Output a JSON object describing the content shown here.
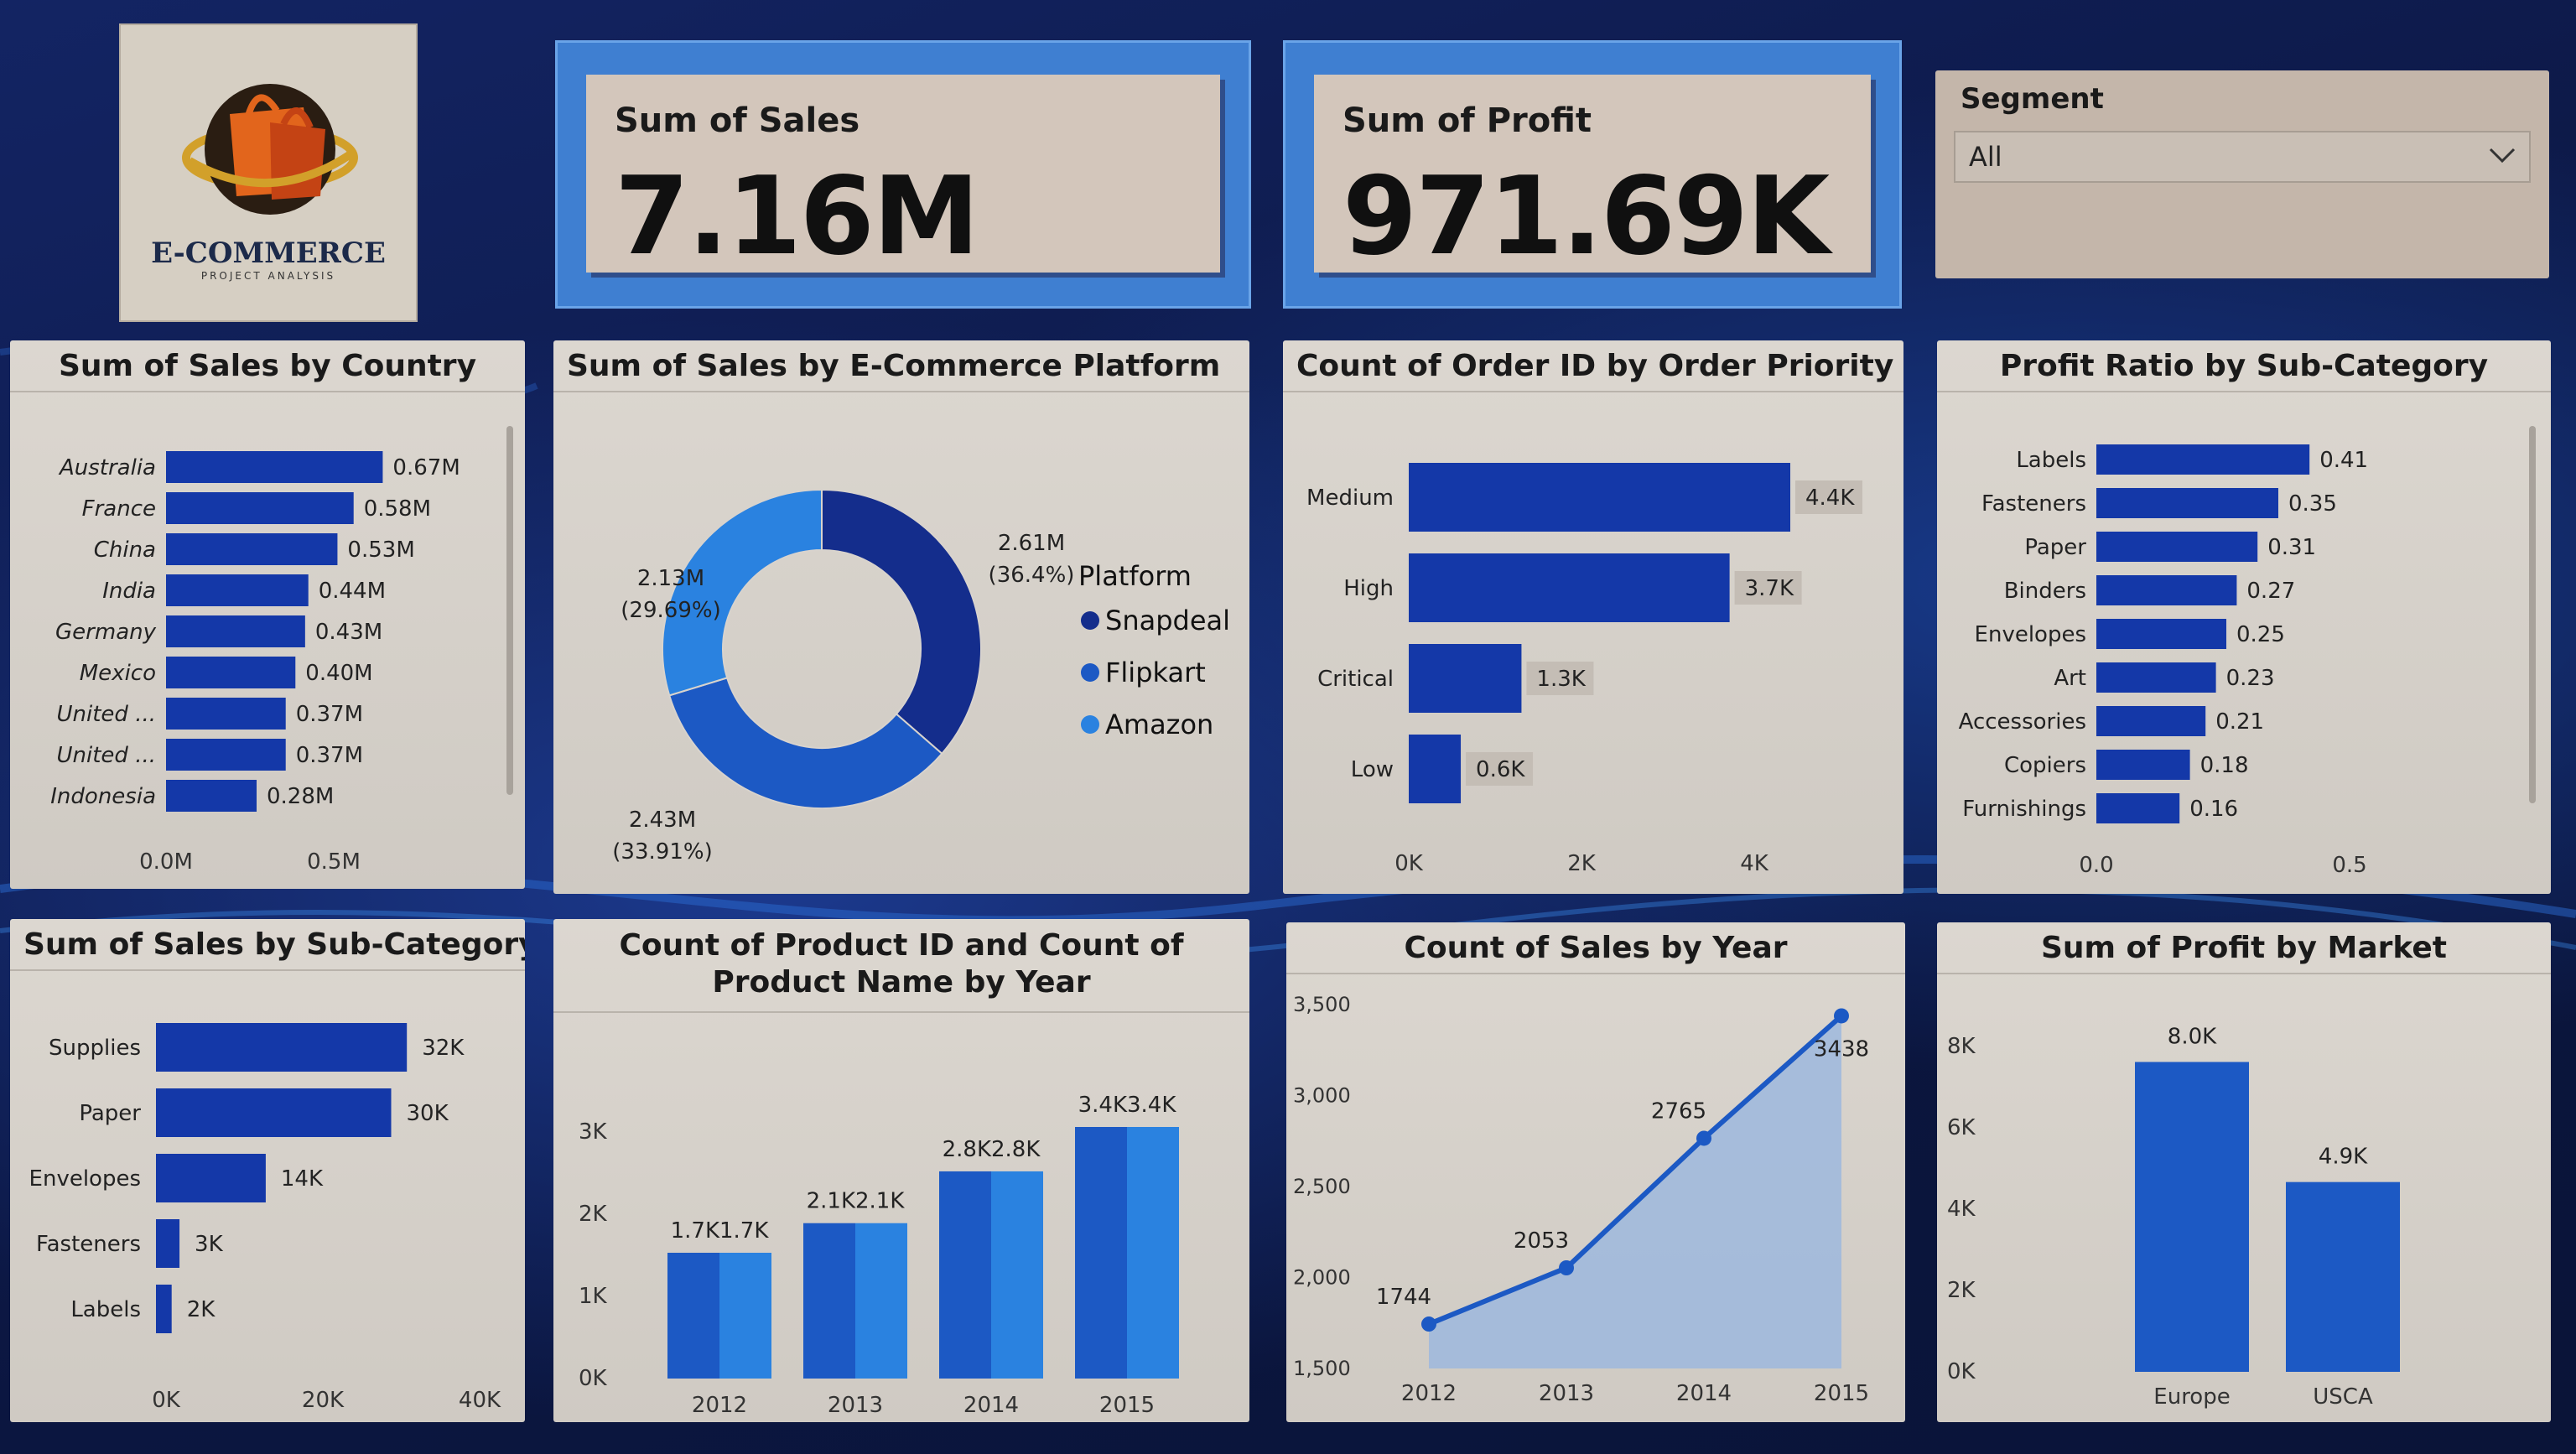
{
  "logo": {
    "name": "E-COMMERCE",
    "tagline": "PROJECT ANALYSIS"
  },
  "kpis": {
    "sales": {
      "label": "Sum of Sales",
      "value": "7.16M"
    },
    "profit": {
      "label": "Sum of Profit",
      "value": "971.69K"
    }
  },
  "segment": {
    "label": "Segment",
    "value": "All"
  },
  "colors": {
    "bar": "#1438a8",
    "bar_light": "#1f6fd6",
    "panel": "#d8d3cd",
    "accent": "#3f7fd1"
  },
  "chart_data": [
    {
      "id": "sales_by_country",
      "type": "bar",
      "orientation": "horizontal",
      "title": "Sum of Sales by Country",
      "categories": [
        "Australia",
        "France",
        "China",
        "India",
        "Germany",
        "Mexico",
        "United ...",
        "United ...",
        "Indonesia"
      ],
      "values": [
        0.67,
        0.58,
        0.53,
        0.44,
        0.43,
        0.4,
        0.37,
        0.37,
        0.28
      ],
      "labels": [
        "0.67M",
        "0.58M",
        "0.53M",
        "0.44M",
        "0.43M",
        "0.40M",
        "0.37M",
        "0.37M",
        "0.28M"
      ],
      "xlim": [
        0,
        0.7
      ],
      "xticks": [
        "0.0M",
        "0.5M"
      ]
    },
    {
      "id": "sales_by_platform",
      "type": "pie",
      "title": "Sum of Sales by E-Commerce Platform",
      "legend_title": "Platform",
      "slices": [
        {
          "name": "Snapdeal",
          "value": 2.61,
          "label": "2.61M",
          "pct": "(36.4%)",
          "color": "#142d8c"
        },
        {
          "name": "Flipkart",
          "value": 2.43,
          "label": "2.43M",
          "pct": "(33.91%)",
          "color": "#1c59c4"
        },
        {
          "name": "Amazon",
          "value": 2.13,
          "label": "2.13M",
          "pct": "(29.69%)",
          "color": "#2a82e0"
        }
      ]
    },
    {
      "id": "orders_by_priority",
      "type": "bar",
      "orientation": "horizontal",
      "title": "Count of Order ID by Order Priority",
      "categories": [
        "Medium",
        "High",
        "Critical",
        "Low"
      ],
      "values": [
        4.4,
        3.7,
        1.3,
        0.6
      ],
      "labels": [
        "4.4K",
        "3.7K",
        "1.3K",
        "0.6K"
      ],
      "xlim": [
        0,
        4.4
      ],
      "xticks": [
        "0K",
        "2K",
        "4K"
      ]
    },
    {
      "id": "profit_ratio_by_subcategory",
      "type": "bar",
      "orientation": "horizontal",
      "title": "Profit Ratio by Sub-Category",
      "categories": [
        "Labels",
        "Fasteners",
        "Paper",
        "Binders",
        "Envelopes",
        "Art",
        "Accessories",
        "Copiers",
        "Furnishings"
      ],
      "values": [
        0.41,
        0.35,
        0.31,
        0.27,
        0.25,
        0.23,
        0.21,
        0.18,
        0.16
      ],
      "labels": [
        "0.41",
        "0.35",
        "0.31",
        "0.27",
        "0.25",
        "0.23",
        "0.21",
        "0.18",
        "0.16"
      ],
      "xlim": [
        0,
        0.5
      ],
      "xticks": [
        "0.0",
        "0.5"
      ]
    },
    {
      "id": "sales_by_subcategory",
      "type": "bar",
      "orientation": "horizontal",
      "title": "Sum of Sales by Sub-Category",
      "categories": [
        "Supplies",
        "Paper",
        "Envelopes",
        "Fasteners",
        "Labels"
      ],
      "values": [
        32,
        30,
        14,
        3,
        2
      ],
      "labels": [
        "32K",
        "30K",
        "14K",
        "3K",
        "2K"
      ],
      "xlim": [
        0,
        40
      ],
      "xticks": [
        "0K",
        "20K",
        "40K"
      ]
    },
    {
      "id": "product_counts_by_year",
      "type": "bar",
      "title": "Count of Product ID and Count of Product Name by Year",
      "categories": [
        "2012",
        "2013",
        "2014",
        "2015"
      ],
      "series": [
        {
          "values": [
            1.7,
            2.1,
            2.8,
            3.4
          ],
          "labels": [
            "1.7K",
            "2.1K",
            "2.8K",
            "3.4K"
          ],
          "color": "#1c59c4"
        },
        {
          "values": [
            1.7,
            2.1,
            2.8,
            3.4
          ],
          "labels": [
            "1.7K",
            "2.1K",
            "2.8K",
            "3.4K"
          ],
          "color": "#2a82e0"
        }
      ],
      "ylim": [
        0,
        3.4
      ],
      "yticks": [
        "0K",
        "1K",
        "2K",
        "3K"
      ]
    },
    {
      "id": "sales_count_by_year",
      "type": "area",
      "title": "Count of Sales by Year",
      "x": [
        "2012",
        "2013",
        "2014",
        "2015"
      ],
      "values": [
        1744,
        2053,
        2765,
        3438
      ],
      "labels": [
        "1744",
        "2053",
        "2765",
        "3438"
      ],
      "ylim": [
        1500,
        3500
      ],
      "yticks": [
        "1,500",
        "2,000",
        "2,500",
        "3,000",
        "3,500"
      ]
    },
    {
      "id": "profit_by_market",
      "type": "bar",
      "title": "Sum of Profit by Market",
      "categories": [
        "Europe",
        "USCA"
      ],
      "values": [
        8.0,
        4.9
      ],
      "labels": [
        "8.0K",
        "4.9K"
      ],
      "ylim": [
        0,
        8.4
      ],
      "yticks": [
        "0K",
        "2K",
        "4K",
        "6K",
        "8K"
      ]
    }
  ]
}
